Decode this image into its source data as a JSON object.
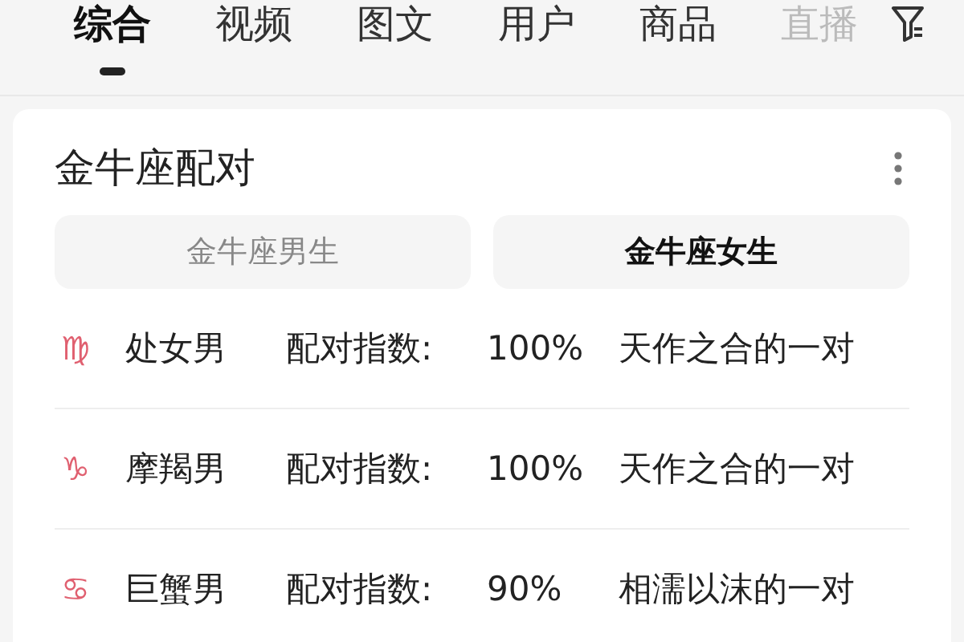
{
  "tabs": [
    {
      "label": "综合",
      "selected": true
    },
    {
      "label": "视频",
      "selected": false
    },
    {
      "label": "图文",
      "selected": false
    },
    {
      "label": "用户",
      "selected": false
    },
    {
      "label": "商品",
      "selected": false
    },
    {
      "label": "直播",
      "selected": false
    }
  ],
  "card": {
    "title": "金牛座配对",
    "toggles": [
      {
        "label": "金牛座男生",
        "selected": false
      },
      {
        "label": "金牛座女生",
        "selected": true
      }
    ],
    "rows": [
      {
        "symbol": "♍",
        "name": "处女男",
        "index_label": "配对指数:",
        "index": "100%",
        "description": "天作之合的一对"
      },
      {
        "symbol": "♑",
        "name": "摩羯男",
        "index_label": "配对指数:",
        "index": "100%",
        "description": "天作之合的一对"
      },
      {
        "symbol": "♋",
        "name": "巨蟹男",
        "index_label": "配对指数:",
        "index": "90%",
        "description": "相濡以沫的一对"
      }
    ]
  }
}
